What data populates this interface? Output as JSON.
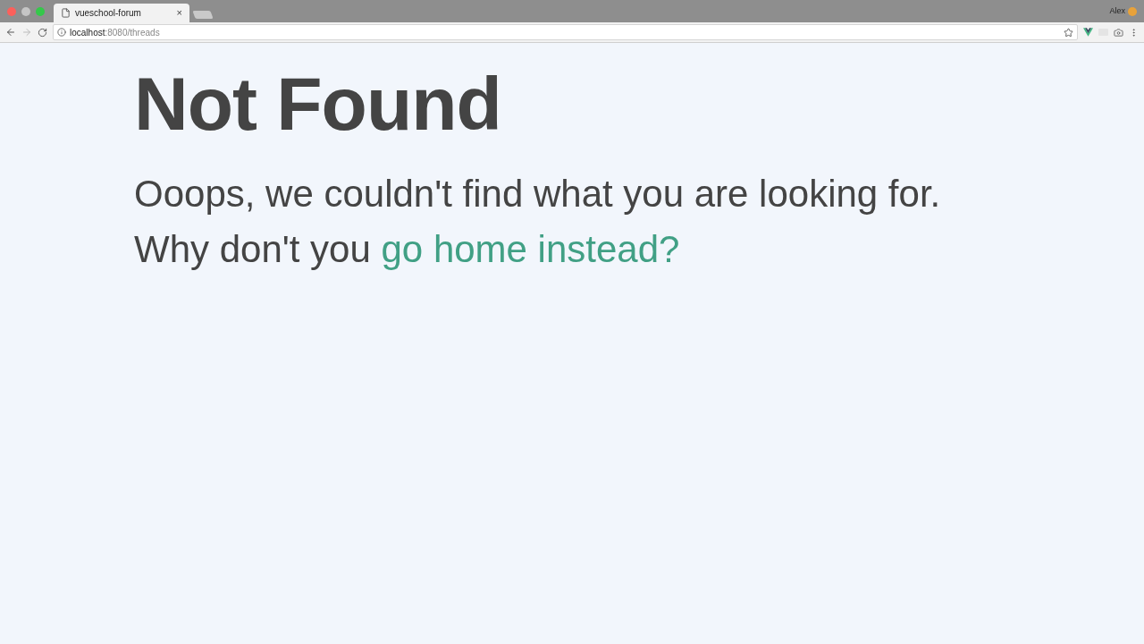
{
  "browser": {
    "tab": {
      "title": "vueschool-forum",
      "close": "×"
    },
    "address": {
      "host": "localhost",
      "path": ":8080/threads"
    },
    "user": "Alex"
  },
  "page": {
    "heading": "Not Found",
    "message": "Ooops, we couldn't find what you are looking for.",
    "prompt": "Why don't you",
    "link": "go home instead?"
  }
}
